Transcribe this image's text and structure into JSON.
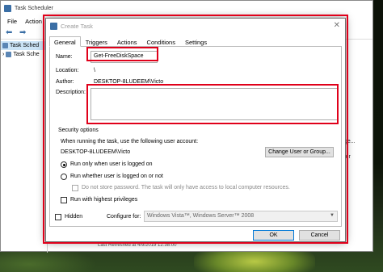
{
  "background_window": {
    "title": "Task Scheduler",
    "menu": [
      "File",
      "Action"
    ],
    "tree": [
      "Task Sched",
      "Task Sche"
    ],
    "right_text_1": "ge...",
    "right_text_2": "ler",
    "bottom_text": "Last Refreshed at 4/9/2019 12:38:00"
  },
  "dialog": {
    "title": "Create Task",
    "tabs": [
      "General",
      "Triggers",
      "Actions",
      "Conditions",
      "Settings"
    ],
    "name_label": "Name:",
    "name_value": "Get-FreeDiskSpace",
    "location_label": "Location:",
    "location_value": "\\",
    "author_label": "Author:",
    "author_value": "DESKTOP-8LUDEEM\\Victo",
    "description_label": "Description:",
    "description_value": "",
    "security_title": "Security options",
    "security_prompt": "When running the task, use the following user account:",
    "user_account": "DESKTOP-8LUDEEM\\Victo",
    "change_user_button": "Change User or Group...",
    "radio_logged_on": "Run only when user is logged on",
    "radio_whether": "Run whether user is logged on or not",
    "no_store_password": "Do not store password.  The task will only have access to local computer resources.",
    "highest_privileges": "Run with highest privileges",
    "hidden_label": "Hidden",
    "configure_for_label": "Configure for:",
    "configure_for_value": "Windows Vista™, Windows Server™ 2008",
    "ok_button": "OK",
    "cancel_button": "Cancel"
  },
  "colors": {
    "highlight": "#e0001a",
    "accent": "#0078d7"
  }
}
